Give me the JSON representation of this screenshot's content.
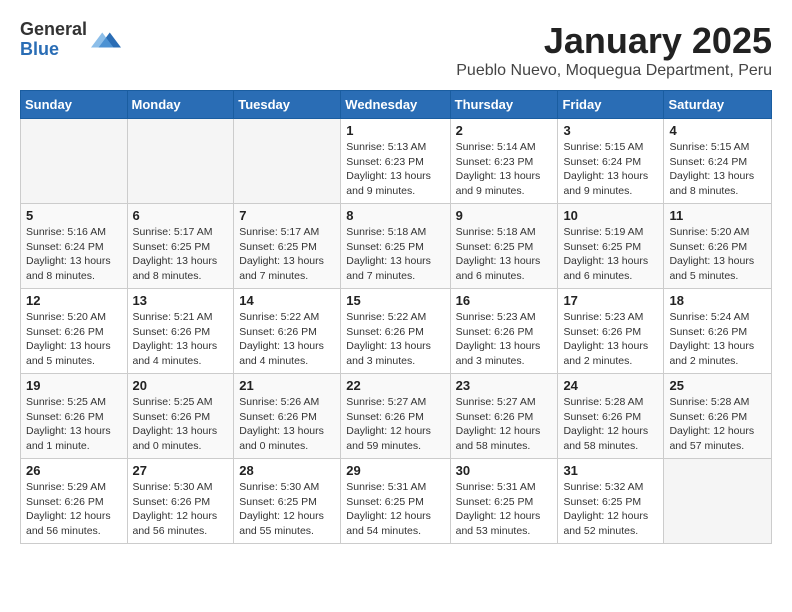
{
  "header": {
    "logo_general": "General",
    "logo_blue": "Blue",
    "title": "January 2025",
    "subtitle": "Pueblo Nuevo, Moquegua Department, Peru"
  },
  "weekdays": [
    "Sunday",
    "Monday",
    "Tuesday",
    "Wednesday",
    "Thursday",
    "Friday",
    "Saturday"
  ],
  "weeks": [
    [
      {
        "day": "",
        "info": ""
      },
      {
        "day": "",
        "info": ""
      },
      {
        "day": "",
        "info": ""
      },
      {
        "day": "1",
        "info": "Sunrise: 5:13 AM\nSunset: 6:23 PM\nDaylight: 13 hours\nand 9 minutes."
      },
      {
        "day": "2",
        "info": "Sunrise: 5:14 AM\nSunset: 6:23 PM\nDaylight: 13 hours\nand 9 minutes."
      },
      {
        "day": "3",
        "info": "Sunrise: 5:15 AM\nSunset: 6:24 PM\nDaylight: 13 hours\nand 9 minutes."
      },
      {
        "day": "4",
        "info": "Sunrise: 5:15 AM\nSunset: 6:24 PM\nDaylight: 13 hours\nand 8 minutes."
      }
    ],
    [
      {
        "day": "5",
        "info": "Sunrise: 5:16 AM\nSunset: 6:24 PM\nDaylight: 13 hours\nand 8 minutes."
      },
      {
        "day": "6",
        "info": "Sunrise: 5:17 AM\nSunset: 6:25 PM\nDaylight: 13 hours\nand 8 minutes."
      },
      {
        "day": "7",
        "info": "Sunrise: 5:17 AM\nSunset: 6:25 PM\nDaylight: 13 hours\nand 7 minutes."
      },
      {
        "day": "8",
        "info": "Sunrise: 5:18 AM\nSunset: 6:25 PM\nDaylight: 13 hours\nand 7 minutes."
      },
      {
        "day": "9",
        "info": "Sunrise: 5:18 AM\nSunset: 6:25 PM\nDaylight: 13 hours\nand 6 minutes."
      },
      {
        "day": "10",
        "info": "Sunrise: 5:19 AM\nSunset: 6:25 PM\nDaylight: 13 hours\nand 6 minutes."
      },
      {
        "day": "11",
        "info": "Sunrise: 5:20 AM\nSunset: 6:26 PM\nDaylight: 13 hours\nand 5 minutes."
      }
    ],
    [
      {
        "day": "12",
        "info": "Sunrise: 5:20 AM\nSunset: 6:26 PM\nDaylight: 13 hours\nand 5 minutes."
      },
      {
        "day": "13",
        "info": "Sunrise: 5:21 AM\nSunset: 6:26 PM\nDaylight: 13 hours\nand 4 minutes."
      },
      {
        "day": "14",
        "info": "Sunrise: 5:22 AM\nSunset: 6:26 PM\nDaylight: 13 hours\nand 4 minutes."
      },
      {
        "day": "15",
        "info": "Sunrise: 5:22 AM\nSunset: 6:26 PM\nDaylight: 13 hours\nand 3 minutes."
      },
      {
        "day": "16",
        "info": "Sunrise: 5:23 AM\nSunset: 6:26 PM\nDaylight: 13 hours\nand 3 minutes."
      },
      {
        "day": "17",
        "info": "Sunrise: 5:23 AM\nSunset: 6:26 PM\nDaylight: 13 hours\nand 2 minutes."
      },
      {
        "day": "18",
        "info": "Sunrise: 5:24 AM\nSunset: 6:26 PM\nDaylight: 13 hours\nand 2 minutes."
      }
    ],
    [
      {
        "day": "19",
        "info": "Sunrise: 5:25 AM\nSunset: 6:26 PM\nDaylight: 13 hours\nand 1 minute."
      },
      {
        "day": "20",
        "info": "Sunrise: 5:25 AM\nSunset: 6:26 PM\nDaylight: 13 hours\nand 0 minutes."
      },
      {
        "day": "21",
        "info": "Sunrise: 5:26 AM\nSunset: 6:26 PM\nDaylight: 13 hours\nand 0 minutes."
      },
      {
        "day": "22",
        "info": "Sunrise: 5:27 AM\nSunset: 6:26 PM\nDaylight: 12 hours\nand 59 minutes."
      },
      {
        "day": "23",
        "info": "Sunrise: 5:27 AM\nSunset: 6:26 PM\nDaylight: 12 hours\nand 58 minutes."
      },
      {
        "day": "24",
        "info": "Sunrise: 5:28 AM\nSunset: 6:26 PM\nDaylight: 12 hours\nand 58 minutes."
      },
      {
        "day": "25",
        "info": "Sunrise: 5:28 AM\nSunset: 6:26 PM\nDaylight: 12 hours\nand 57 minutes."
      }
    ],
    [
      {
        "day": "26",
        "info": "Sunrise: 5:29 AM\nSunset: 6:26 PM\nDaylight: 12 hours\nand 56 minutes."
      },
      {
        "day": "27",
        "info": "Sunrise: 5:30 AM\nSunset: 6:26 PM\nDaylight: 12 hours\nand 56 minutes."
      },
      {
        "day": "28",
        "info": "Sunrise: 5:30 AM\nSunset: 6:25 PM\nDaylight: 12 hours\nand 55 minutes."
      },
      {
        "day": "29",
        "info": "Sunrise: 5:31 AM\nSunset: 6:25 PM\nDaylight: 12 hours\nand 54 minutes."
      },
      {
        "day": "30",
        "info": "Sunrise: 5:31 AM\nSunset: 6:25 PM\nDaylight: 12 hours\nand 53 minutes."
      },
      {
        "day": "31",
        "info": "Sunrise: 5:32 AM\nSunset: 6:25 PM\nDaylight: 12 hours\nand 52 minutes."
      },
      {
        "day": "",
        "info": ""
      }
    ]
  ]
}
